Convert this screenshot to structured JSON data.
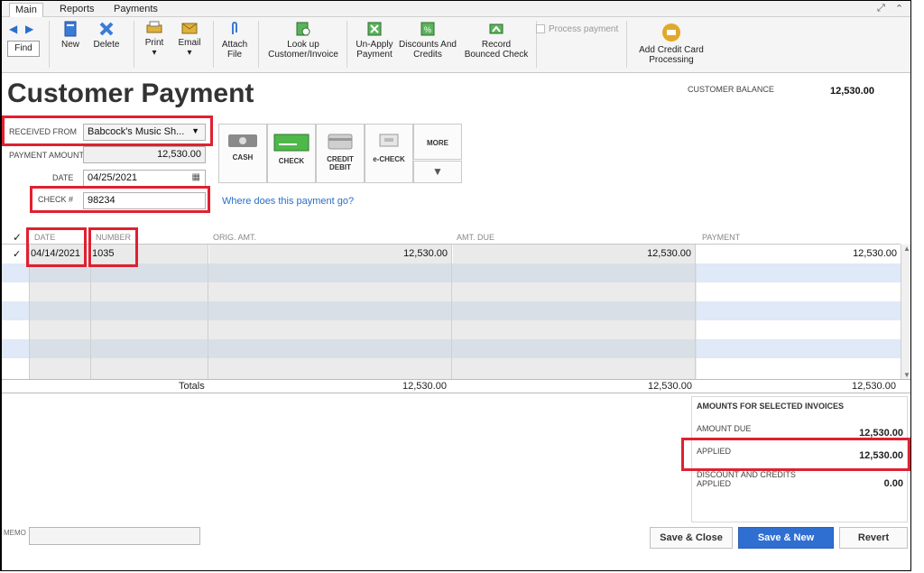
{
  "tabs": [
    "Main",
    "Reports",
    "Payments"
  ],
  "window_controls": [
    "↗",
    "^"
  ],
  "toolbar": {
    "find": "Find",
    "new": "New",
    "delete": "Delete",
    "print": "Print",
    "email": "Email",
    "attach": [
      "Attach",
      "File"
    ],
    "lookup": [
      "Look up",
      "Customer/Invoice"
    ],
    "unapply": [
      "Un-Apply",
      "Payment"
    ],
    "discounts": [
      "Discounts And",
      "Credits"
    ],
    "record_bounced": [
      "Record",
      "Bounced Check"
    ],
    "process_payment": "Process payment",
    "add_cc": [
      "Add Credit Card",
      "Processing"
    ]
  },
  "page_title": "Customer Payment",
  "customer_balance": {
    "label": "CUSTOMER BALANCE",
    "value": "12,530.00"
  },
  "form": {
    "received_from_label": "RECEIVED FROM",
    "received_from_value": "Babcock's Music Sh...",
    "payment_amount_label": "PAYMENT AMOUNT",
    "payment_amount_value": "12,530.00",
    "date_label": "DATE",
    "date_value": "04/25/2021",
    "check_label": "CHECK #",
    "check_value": "98234"
  },
  "payment_methods": [
    {
      "label": "CASH",
      "icon": "cash-icon"
    },
    {
      "label": "CHECK",
      "icon": "check-icon"
    },
    {
      "label": "CREDIT\nDEBIT",
      "icon": "credit-card-icon"
    },
    {
      "label": "e-CHECK",
      "icon": "echeck-icon"
    }
  ],
  "more_label": "MORE",
  "where_link": "Where does this payment go?",
  "grid": {
    "headers": [
      "DATE",
      "NUMBER",
      "ORIG. AMT.",
      "AMT. DUE",
      "PAYMENT"
    ],
    "rows": [
      {
        "checked": "✓",
        "date": "04/14/2021",
        "number": "1035",
        "orig": "12,530.00",
        "due": "12,530.00",
        "payment": "12,530.00"
      }
    ]
  },
  "totals": {
    "label": "Totals",
    "orig": "12,530.00",
    "due": "12,530.00",
    "payment": "12,530.00"
  },
  "amounts_panel": {
    "title": "AMOUNTS FOR SELECTED INVOICES",
    "amount_due_label": "AMOUNT DUE",
    "amount_due_value": "12,530.00",
    "applied_label": "APPLIED",
    "applied_value": "12,530.00",
    "discount_label_1": "DISCOUNT AND CREDITS",
    "discount_label_2": "APPLIED",
    "discount_value": "0.00"
  },
  "memo_label": "MEMO",
  "buttons": {
    "save_close": "Save & Close",
    "save_new": "Save & New",
    "revert": "Revert"
  },
  "colors": {
    "accent": "#2f6fd1",
    "highlight": "#e02030",
    "row_stripe": "#dfe9f7"
  }
}
